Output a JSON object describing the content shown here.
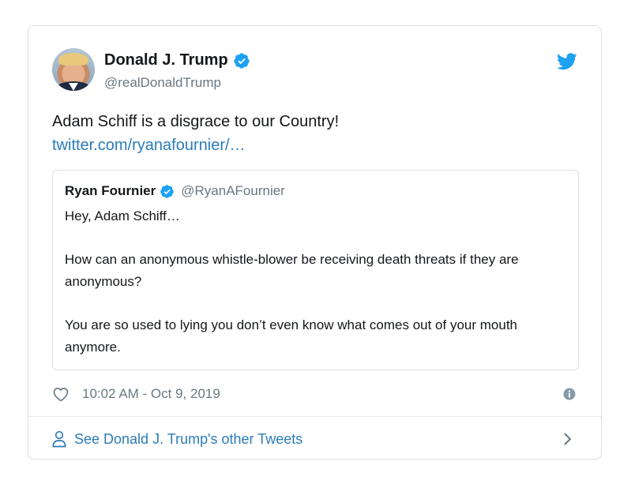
{
  "author": {
    "name": "Donald J. Trump",
    "handle": "@realDonaldTrump",
    "verified": true
  },
  "tweet": {
    "text": "Adam Schiff is a disgrace to our Country!",
    "link": "twitter.com/ryanafournier/…"
  },
  "quoted_tweet": {
    "name": "Ryan Fournier",
    "handle": "@RyanAFournier",
    "verified": true,
    "paragraphs": [
      "Hey, Adam Schiff…",
      "How can an anonymous whistle-blower be receiving death threats if they are anonymous?",
      "You are so used to lying you don’t even know what comes out of your mouth anymore."
    ]
  },
  "meta": {
    "timestamp": "10:02 AM - Oct 9, 2019"
  },
  "footer": {
    "label": "See Donald J. Trump's other Tweets"
  },
  "icons": {
    "verified": "verified-badge-icon",
    "bird": "twitter-bird-icon",
    "heart": "heart-outline-icon",
    "info": "info-icon",
    "person": "person-icon",
    "chevron": "chevron-right-icon"
  },
  "colors": {
    "twitter_blue": "#1da1f2",
    "link_blue": "#2b7bb9",
    "secondary_text": "#697882",
    "border": "#d9e0e6"
  }
}
